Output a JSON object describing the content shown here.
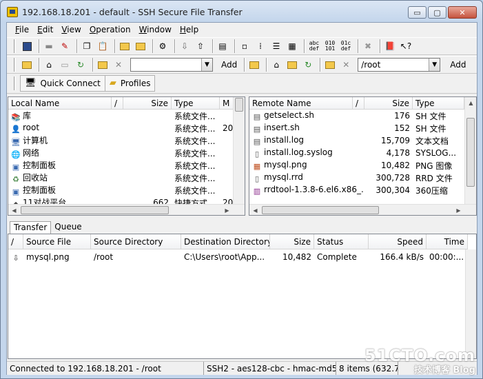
{
  "window": {
    "title": "192.168.18.201 - default - SSH Secure File Transfer",
    "buttons": {
      "minimize": "▭",
      "maximize": "▢",
      "close": "✕"
    }
  },
  "menu": [
    {
      "key": "F",
      "rest": "ile"
    },
    {
      "key": "E",
      "rest": "dit"
    },
    {
      "key": "V",
      "rest": "iew"
    },
    {
      "key": "O",
      "rest": "peration"
    },
    {
      "key": "W",
      "rest": "indow"
    },
    {
      "key": "H",
      "rest": "elp"
    }
  ],
  "toolbar2": {
    "local_path": "",
    "remote_path": "/root",
    "add_label": "Add"
  },
  "quickbar": {
    "quick_connect": "Quick Connect",
    "profiles": "Profiles"
  },
  "local": {
    "columns": [
      "Local Name",
      "/",
      "Size",
      "Type",
      "M"
    ],
    "rows": [
      {
        "name": "库",
        "size": "",
        "type": "系统文件...",
        "mod": "",
        "icon": "library"
      },
      {
        "name": "root",
        "size": "",
        "type": "系统文件...",
        "mod": "20",
        "icon": "user-folder"
      },
      {
        "name": "计算机",
        "size": "",
        "type": "系统文件...",
        "mod": "",
        "icon": "computer"
      },
      {
        "name": "网络",
        "size": "",
        "type": "系统文件...",
        "mod": "",
        "icon": "network"
      },
      {
        "name": "控制面板",
        "size": "",
        "type": "系统文件...",
        "mod": "",
        "icon": "control-panel"
      },
      {
        "name": "回收站",
        "size": "",
        "type": "系统文件...",
        "mod": "",
        "icon": "recycle-bin"
      },
      {
        "name": "控制面板",
        "size": "",
        "type": "系统文件...",
        "mod": "",
        "icon": "control-panel"
      },
      {
        "name": "11对战平台",
        "size": "662",
        "type": "快捷方式",
        "mod": "20",
        "icon": "shortcut"
      }
    ]
  },
  "remote": {
    "columns": [
      "Remote Name",
      "/",
      "Size",
      "Type"
    ],
    "rows": [
      {
        "name": "getselect.sh",
        "size": "176",
        "type": "SH 文件",
        "icon": "script"
      },
      {
        "name": "insert.sh",
        "size": "152",
        "type": "SH 文件",
        "icon": "script"
      },
      {
        "name": "install.log",
        "size": "15,709",
        "type": "文本文档",
        "icon": "text"
      },
      {
        "name": "install.log.syslog",
        "size": "4,178",
        "type": "SYSLOG...",
        "icon": "file"
      },
      {
        "name": "mysql.png",
        "size": "10,482",
        "type": "PNG 图像",
        "icon": "image"
      },
      {
        "name": "mysql.rrd",
        "size": "300,728",
        "type": "RRD 文件",
        "icon": "file"
      },
      {
        "name": "rrdtool-1.3.8-6.el6.x86_...",
        "size": "300,304",
        "type": "360压缩",
        "icon": "archive"
      }
    ]
  },
  "tabs": [
    "Transfer",
    "Queue"
  ],
  "transfer": {
    "columns": [
      "/",
      "Source File",
      "Source Directory",
      "Destination Directory",
      "Size",
      "Status",
      "Speed",
      "Time"
    ],
    "rows": [
      {
        "icon": "download",
        "file": "mysql.png",
        "src": "/root",
        "dst": "C:\\Users\\root\\App...",
        "size": "10,482",
        "status": "Complete",
        "speed": "166.4 kB/s",
        "time": "00:00:..."
      }
    ]
  },
  "status": {
    "connection": "Connected to 192.168.18.201 - /root",
    "cipher": "SSH2 - aes128-cbc - hmac-md5",
    "items": "8 items (632.7..."
  },
  "watermark": {
    "brand": "51CTO.com",
    "sub": "技术博客",
    "blog": "Blog"
  }
}
